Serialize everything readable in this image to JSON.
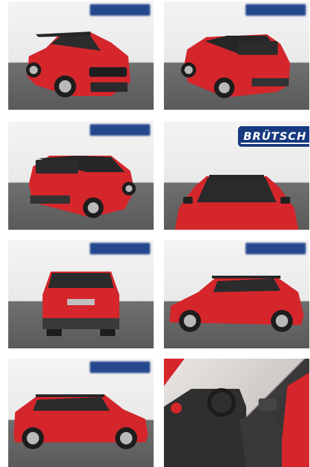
{
  "gallery": {
    "photos": [
      {
        "view": "front-left",
        "car_color": "#d4262b",
        "roof_color": "#262626"
      },
      {
        "view": "rear-left",
        "car_color": "#d4262b",
        "roof_color": "#262626"
      },
      {
        "view": "rear-right",
        "car_color": "#d4262b",
        "roof_color": "#262626"
      },
      {
        "view": "front",
        "car_color": "#d4262b",
        "roof_color": "#262626"
      },
      {
        "view": "rear",
        "car_color": "#d4262b",
        "roof_color": "#262626"
      },
      {
        "view": "side-left",
        "car_color": "#d4262b",
        "roof_color": "#262626"
      },
      {
        "view": "side-right",
        "car_color": "#d4262b",
        "roof_color": "#262626"
      },
      {
        "view": "interior",
        "car_color": "#d4262b",
        "roof_color": "#262626"
      }
    ],
    "dealer_logo_text": "BRÜTSCH",
    "badge_color": "#1b3e88"
  }
}
